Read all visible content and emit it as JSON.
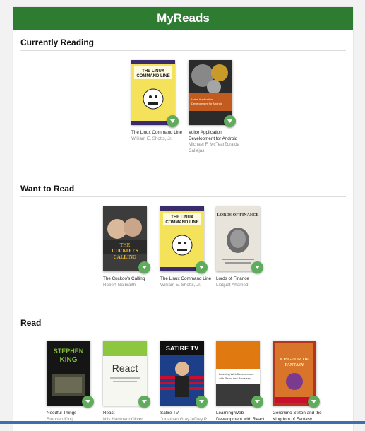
{
  "header": {
    "title": "MyReads"
  },
  "shelves": [
    {
      "title": "Currently Reading",
      "books": [
        {
          "title": "The Linux Command Line",
          "authors": "William E. Shotts, Jr.",
          "cover_text": "THE LINUX COMMAND LINE"
        },
        {
          "title": "Voice Application Development for Android",
          "authors": "Michael F. McTearZoraida Callejas",
          "cover_text": "Voice Application Development for Android"
        }
      ]
    },
    {
      "title": "Want to Read",
      "books": [
        {
          "title": "The Cuckoo's Calling",
          "authors": "Robert Galbraith",
          "cover_text": "THE CUCKOO'S CALLING"
        },
        {
          "title": "The Linux Command Line",
          "authors": "William E. Shotts, Jr.",
          "cover_text": "THE LINUX COMMAND LINE"
        },
        {
          "title": "Lords of Finance",
          "authors": "Liaquat Ahamed",
          "cover_text": "LORDS OF FINANCE"
        }
      ]
    },
    {
      "title": "Read",
      "books": [
        {
          "title": "Needful Things",
          "authors": "Stephen King",
          "cover_text": "STEPHEN KING"
        },
        {
          "title": "React",
          "authors": "Nils HartmannOliver",
          "cover_text": "React"
        },
        {
          "title": "Satire TV",
          "authors": "Jonathan GrayJeffrey P.",
          "cover_text": "SATIRE TV"
        },
        {
          "title": "Learning Web Development with React",
          "authors": "",
          "cover_text": "Learning Web Development with React and Bootstrap"
        },
        {
          "title": "Geronimo Stilton and the Kingdom of Fantasy",
          "authors": "",
          "cover_text": "KINGDOM OF FANTASY"
        }
      ]
    }
  ],
  "colors": {
    "header": "#2e7c31",
    "shelf_button": "#60ac5d"
  },
  "icons": {
    "shelf_button": "triangle-down-icon"
  }
}
